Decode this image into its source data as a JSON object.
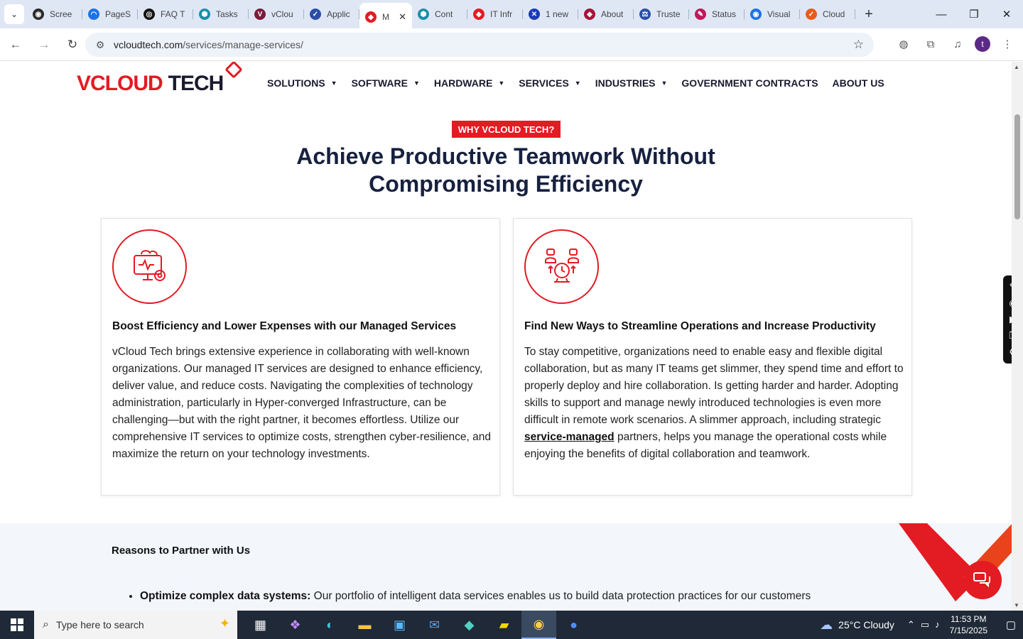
{
  "browser": {
    "tabs": [
      {
        "label": "Scree",
        "color": "#2b2b2b",
        "glyph": "◉"
      },
      {
        "label": "PageS",
        "color": "#1a73e8",
        "glyph": "◠"
      },
      {
        "label": "FAQ T",
        "color": "#111111",
        "glyph": "◎"
      },
      {
        "label": "Tasks",
        "color": "#1b8fa8",
        "glyph": "⬢"
      },
      {
        "label": "vClou",
        "color": "#7b1b3a",
        "glyph": "V"
      },
      {
        "label": "Applic",
        "color": "#2b4fa8",
        "glyph": "✓"
      },
      {
        "label": "M",
        "color": "#e31b23",
        "glyph": "◆"
      },
      {
        "label": "Cont",
        "color": "#1b8fa8",
        "glyph": "⬢"
      },
      {
        "label": "IT Infr",
        "color": "#e31b23",
        "glyph": "◆"
      },
      {
        "label": "1 new",
        "color": "#1a3bb8",
        "glyph": "✕"
      },
      {
        "label": "About",
        "color": "#a8123a",
        "glyph": "◈"
      },
      {
        "label": "Truste",
        "color": "#2b4fa8",
        "glyph": "⚖"
      },
      {
        "label": "Status",
        "color": "#c2185b",
        "glyph": "✎"
      },
      {
        "label": "Visual",
        "color": "#1a73e8",
        "glyph": "◉"
      },
      {
        "label": "Cloud",
        "color": "#e85d1b",
        "glyph": "✓"
      }
    ],
    "active_tab_index": 6,
    "url_host": "vcloudtech.com",
    "url_path": "/services/manage-services/",
    "profile_initial": "t"
  },
  "site": {
    "logo_v": "VCLOUD",
    "logo_tech": "TECH",
    "nav": [
      {
        "label": "SOLUTIONS",
        "dropdown": true
      },
      {
        "label": "SOFTWARE",
        "dropdown": true
      },
      {
        "label": "HARDWARE",
        "dropdown": true
      },
      {
        "label": "SERVICES",
        "dropdown": true
      },
      {
        "label": "INDUSTRIES",
        "dropdown": true
      },
      {
        "label": "GOVERNMENT CONTRACTS",
        "dropdown": false
      },
      {
        "label": "ABOUT US",
        "dropdown": false
      }
    ],
    "why_badge": "WHY VCLOUD TECH?",
    "headline_line1": "Achieve Productive Teamwork Without",
    "headline_line2": "Compromising Efficiency",
    "card_left": {
      "title": "Boost Efficiency and Lower Expenses with our Managed Services",
      "body": "vCloud Tech brings extensive experience in collaborating with well-known organizations. Our managed IT services are designed to enhance efficiency, deliver value, and reduce costs. Navigating the complexities of technology administration, particularly in Hyper-converged Infrastructure, can be challenging—but with the right partner, it becomes effortless. Utilize our comprehensive IT services to optimize costs, strengthen cyber-resilience, and maximize the return on your technology investments."
    },
    "card_right": {
      "title": "Find New Ways to Streamline Operations and Increase Productivity",
      "body_before": "To stay competitive, organizations need to enable easy and flexible digital collaboration, but as many IT teams get slimmer, they spend time and effort to properly deploy and hire collaboration. Is getting harder and harder. Adopting skills to support and manage newly introduced technologies is even more difficult in remote work scenarios. A slimmer approach, including strategic ",
      "link": "service-managed",
      "body_after": " partners, helps you manage the operational costs while enjoying the benefits of digital collaboration and teamwork."
    },
    "reasons_title": "Reasons to Partner with Us",
    "reasons_item_bold": "Optimize complex data systems:",
    "reasons_item_text": " Our portfolio of intelligent data services enables us to build data protection practices for our customers"
  },
  "taskbar": {
    "search_placeholder": "Type here to search",
    "weather": "25°C  Cloudy",
    "time": "11:53 PM",
    "date": "7/15/2025"
  },
  "colors": {
    "accent": "#e31b23",
    "navy": "#17213f"
  }
}
